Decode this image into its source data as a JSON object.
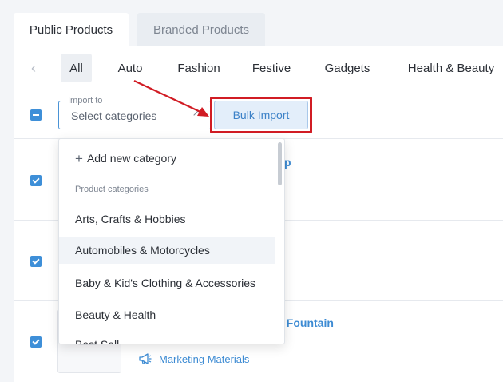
{
  "tabs": {
    "public": "Public Products",
    "branded": "Branded Products"
  },
  "categories": {
    "back_icon": "chevron-left-icon",
    "items": [
      "All",
      "Auto",
      "Fashion",
      "Festive",
      "Gadgets",
      "Health & Beauty"
    ],
    "active": "All"
  },
  "bulk": {
    "select_legend": "Import to",
    "select_placeholder": "Select categories",
    "button": "Bulk Import"
  },
  "dropdown": {
    "add_new": "Add new category",
    "section_label": "Product categories",
    "items": [
      "Arts, Crafts & Hobbies",
      "Automobiles & Motorcycles",
      "Baby & Kid's Clothing & Accessories",
      "Beauty & Health",
      "Best Sell..."
    ],
    "hovered": "Automobiles & Motorcycles"
  },
  "products": [
    {
      "title_visible": "p",
      "checked": true
    },
    {
      "title_visible": "",
      "checked": true
    },
    {
      "title_visible": "ter Fountain",
      "checked": true,
      "meta": "Marketing Materials"
    }
  ],
  "colors": {
    "accent": "#3e8fd8",
    "highlight": "#d11c24",
    "link": "#3d8bd3"
  }
}
